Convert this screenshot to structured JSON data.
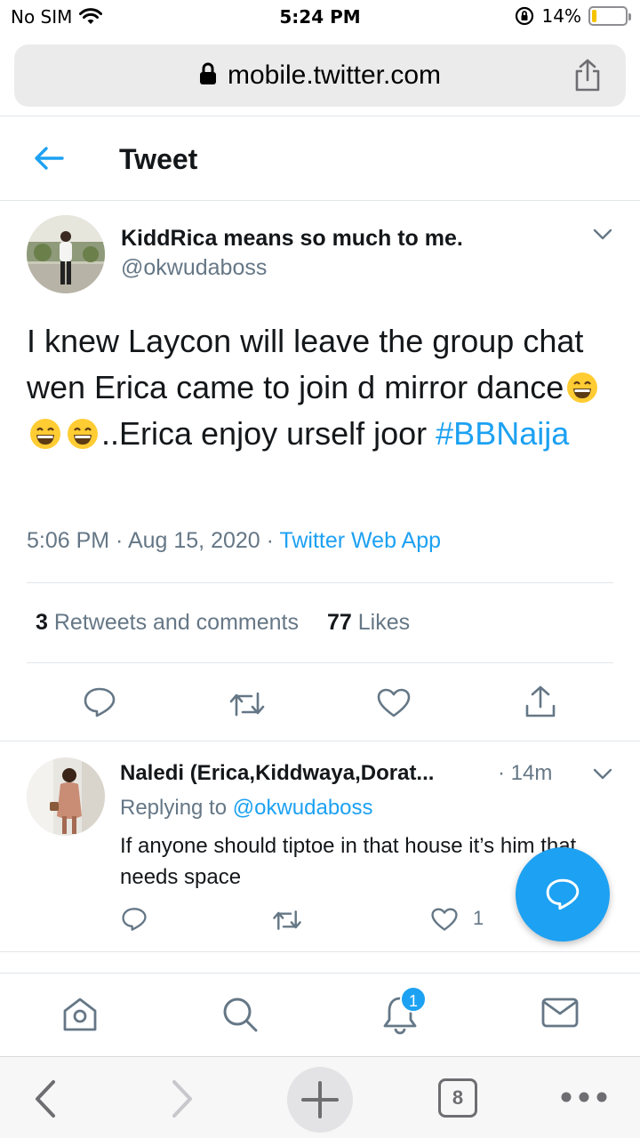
{
  "status_bar": {
    "carrier": "No SIM",
    "time": "5:24 PM",
    "battery_percent": "14%",
    "battery_level": 0.14
  },
  "browser": {
    "url": "mobile.twitter.com",
    "tab_count": "8"
  },
  "header": {
    "title": "Tweet"
  },
  "tweet": {
    "author_name": "KiddRica means so much to me.",
    "author_handle": "@okwudaboss",
    "text_part1": "I knew Laycon will leave the group chat wen Erica came to join d mirror dance",
    "emoji": "😁",
    "text_part2": "..Erica enjoy urself joor ",
    "hashtag": "#BBNaija",
    "time": "5:06 PM · Aug 15, 2020 · ",
    "source": "Twitter Web App",
    "retweets_count": "3",
    "retweets_label": "Retweets and comments",
    "likes_count": "77",
    "likes_label": "Likes"
  },
  "reply": {
    "author_name": "Naledi (Erica,Kiddwaya,Dorat...",
    "time": "· 14m",
    "replying_prefix": "Replying to ",
    "replying_handle": "@okwudaboss",
    "text": "If anyone should tiptoe in that house it’s him that needs space",
    "like_count": "1"
  },
  "bottom_nav": {
    "notification_badge": "1"
  },
  "colors": {
    "accent": "#1da1f2",
    "secondary_text": "#657786",
    "primary_text": "#14171a"
  }
}
